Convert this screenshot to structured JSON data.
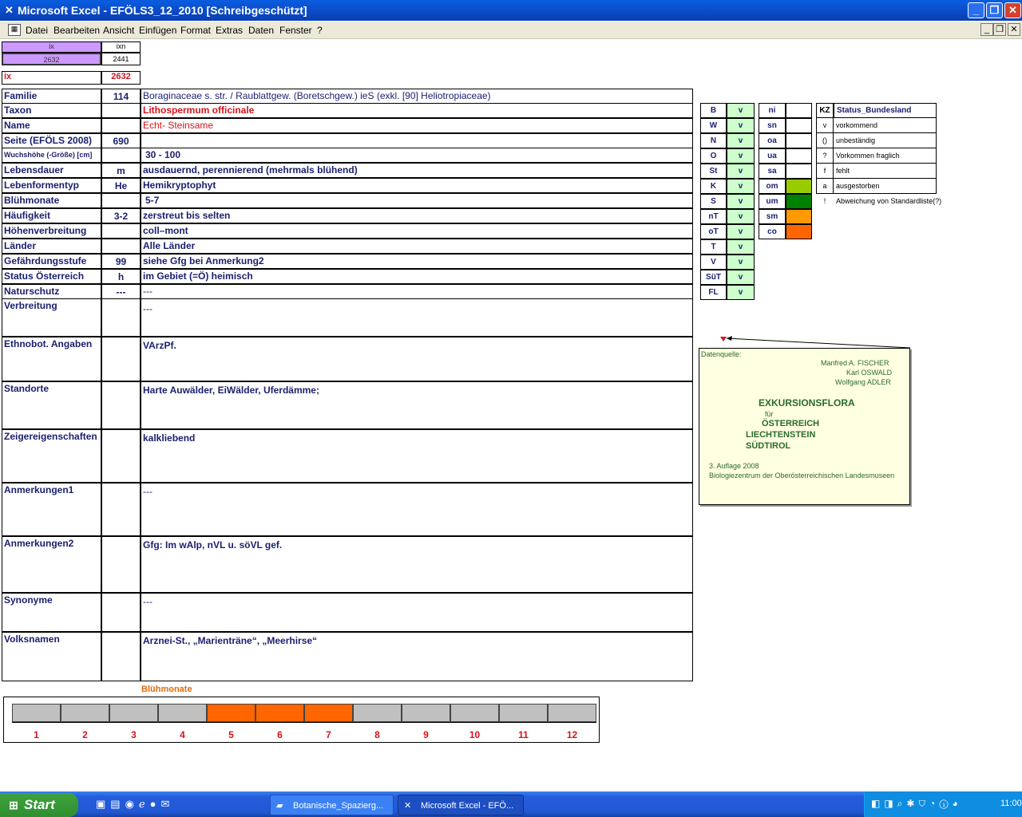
{
  "window": {
    "title": "Microsoft Excel - EFÖLS3_12_2010  [Schreibgeschützt]",
    "btn_min": "_",
    "btn_max": "❐",
    "btn_close": "✕"
  },
  "menu": {
    "items": [
      "Datei",
      "Bearbeiten",
      "Ansicht",
      "Einfügen",
      "Format",
      "Extras",
      "Daten",
      "Fenster",
      "?"
    ],
    "doc_min": "_",
    "doc_restore": "❐",
    "doc_close": "✕"
  },
  "top": {
    "ix_head": "ix",
    "ixn_head": "ixn",
    "ix_val": "2632",
    "ixn_val": "2441",
    "ix_label": "ix",
    "ix_red": "2632"
  },
  "rows": [
    {
      "label": "Familie",
      "mid": "114",
      "value": "Boraginaceae s. str.  /  Raublattgew. (Boretschgew.) ieS (exkl. [90] Heliotropiaceae)"
    },
    {
      "label": "Taxon",
      "mid": "",
      "value": "Lithospermum officinale"
    },
    {
      "label": "Name",
      "mid": "",
      "value": "Echt- Steinsame"
    },
    {
      "label": "Seite (EFÖLS 2008)",
      "mid": "690",
      "value": ""
    },
    {
      "label": "Wuchshöhe (-Größe) [cm]",
      "mid": "",
      "value": "30 - 100"
    },
    {
      "label": "Lebensdauer",
      "mid": "m",
      "value": "ausdauernd, perennierend (mehrmals blühend)"
    },
    {
      "label": "Lebenformentyp",
      "mid": "He",
      "value": "Hemikryptophyt"
    },
    {
      "label": "Blühmonate",
      "mid": "",
      "value": "5-7"
    },
    {
      "label": "Häufigkeit",
      "mid": "3-2",
      "value": "zerstreut bis selten"
    },
    {
      "label": "Höhenverbreitung",
      "mid": "",
      "value": "coll–mont"
    },
    {
      "label": "Länder",
      "mid": "",
      "value": "Alle Länder"
    },
    {
      "label": "Gefährdungsstufe",
      "mid": "99",
      "value": "siehe Gfg bei Anmerkung2"
    },
    {
      "label": "Status Österreich",
      "mid": "h",
      "value": "im Gebiet (=Ö) heimisch"
    },
    {
      "label": "Naturschutz",
      "mid": "---",
      "value": "---"
    },
    {
      "label": "Verbreitung",
      "mid": "",
      "value": "---"
    },
    {
      "label": "Ethnobot. Angaben",
      "mid": "",
      "value": "VArzPf."
    },
    {
      "label": "Standorte",
      "mid": "",
      "value": "Harte Auwälder, EiWälder, Uferdämme;"
    },
    {
      "label": "Zeigereigenschaften",
      "mid": "",
      "value": "kalkliebend"
    },
    {
      "label": "Anmerkungen1",
      "mid": "",
      "value": "---"
    },
    {
      "label": "Anmerkungen2",
      "mid": "",
      "value": "Gfg: Im wAlp, nVL u. söVL gef."
    },
    {
      "label": "Synonyme",
      "mid": "",
      "value": "---"
    },
    {
      "label": "Volksnamen",
      "mid": "",
      "value": "Arznei-St., „Marienträne“, „Meerhirse“"
    }
  ],
  "bundeslaender": [
    {
      "code": "B",
      "status": "v"
    },
    {
      "code": "W",
      "status": "v"
    },
    {
      "code": "N",
      "status": "v"
    },
    {
      "code": "O",
      "status": "v"
    },
    {
      "code": "St",
      "status": "v"
    },
    {
      "code": "K",
      "status": "v"
    },
    {
      "code": "S",
      "status": "v"
    },
    {
      "code": "nT",
      "status": "v"
    },
    {
      "code": "oT",
      "status": "v"
    },
    {
      "code": "T",
      "status": "v"
    },
    {
      "code": "V",
      "status": "v"
    },
    {
      "code": "SüT",
      "status": "v"
    },
    {
      "code": "FL",
      "status": "v"
    }
  ],
  "zones": [
    {
      "code": "ni",
      "color": ""
    },
    {
      "code": "sn",
      "color": ""
    },
    {
      "code": "oa",
      "color": ""
    },
    {
      "code": "ua",
      "color": ""
    },
    {
      "code": "sa",
      "color": ""
    },
    {
      "code": "om",
      "color": "#99cc00"
    },
    {
      "code": "um",
      "color": "#008000"
    },
    {
      "code": "sm",
      "color": "#ff9900"
    },
    {
      "code": "co",
      "color": "#ff6600"
    }
  ],
  "legend": {
    "head_kz": "KZ",
    "head_status": "Status_Bundesland",
    "entries": [
      {
        "kz": "v",
        "text": "vorkommend"
      },
      {
        "kz": "()",
        "text": "unbeständig"
      },
      {
        "kz": "?",
        "text": "Vorkommen fraglich"
      },
      {
        "kz": "f",
        "text": "fehlt"
      },
      {
        "kz": "a",
        "text": "ausgestorben"
      },
      {
        "kz": "!",
        "text": "Abweichung von Standardliste(?)"
      }
    ]
  },
  "note": {
    "label": "Datenquelle:",
    "author1": "Manfred A. FISCHER",
    "author2": "Karl OSWALD",
    "author3": "Wolfgang ADLER",
    "book": "EXKURSIONSFLORA",
    "fuer": "für",
    "c1": "ÖSTERREICH",
    "c2": "LIECHTENSTEIN",
    "c3": "SÜDTIROL",
    "edition": "3. Auflage 2008",
    "publisher": "Biologiezentrum der Oberösterreichischen Landesmuseen"
  },
  "chart_data": {
    "type": "bar",
    "title": "Blühmonate",
    "categories": [
      "1",
      "2",
      "3",
      "4",
      "5",
      "6",
      "7",
      "8",
      "9",
      "10",
      "11",
      "12"
    ],
    "values": [
      0,
      0,
      0,
      0,
      1,
      1,
      1,
      0,
      0,
      0,
      0,
      0
    ],
    "colors": {
      "on": "#ff6600",
      "off": "#c0c0c0"
    }
  },
  "taskbar": {
    "start": "Start",
    "tasks": [
      "Botanische_Spazierg...",
      "Microsoft Excel - EFÖ..."
    ],
    "clock": "11:00"
  }
}
